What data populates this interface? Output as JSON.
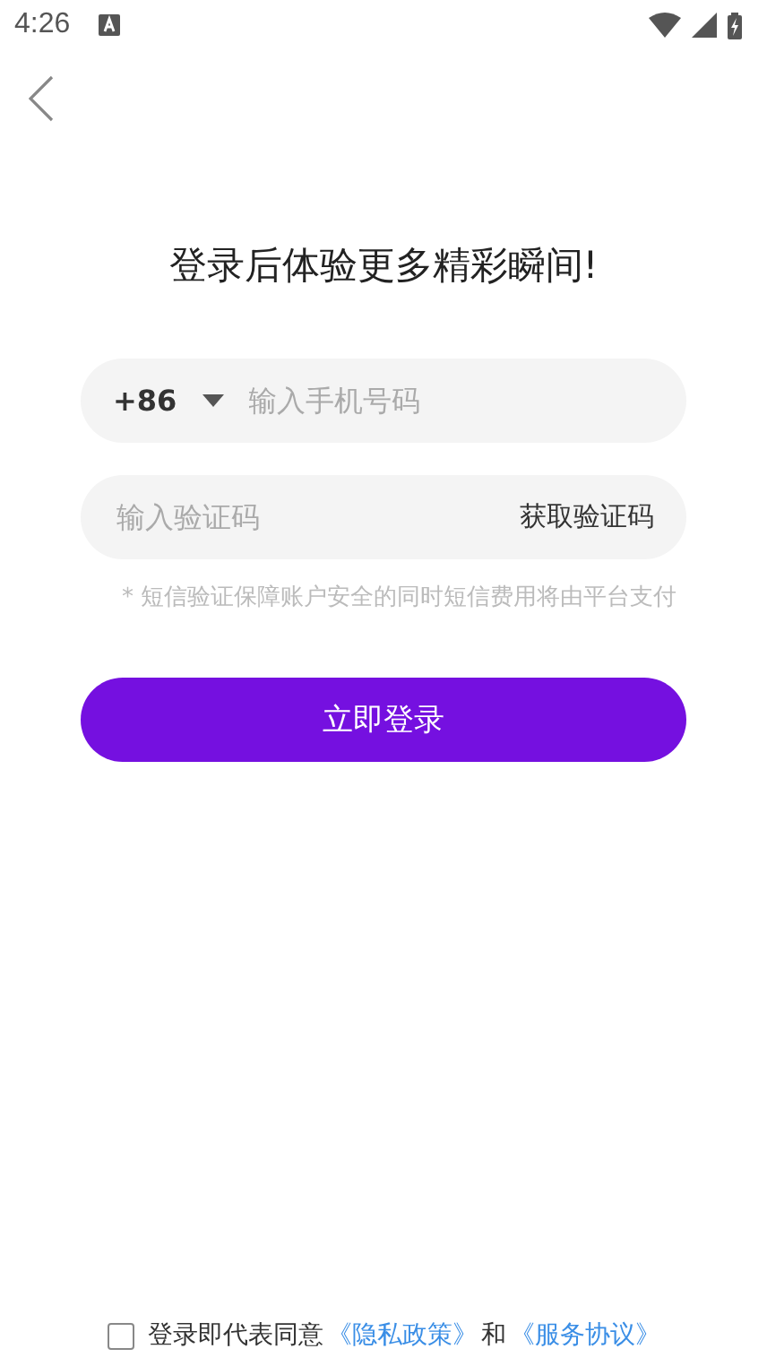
{
  "status_bar": {
    "time": "4:26"
  },
  "title": "登录后体验更多精彩瞬间!",
  "phone_field": {
    "country_code": "+86",
    "placeholder": "输入手机号码"
  },
  "code_field": {
    "placeholder": "输入验证码",
    "action": "获取验证码"
  },
  "note": "* 短信验证保障账户安全的同时短信费用将由平台支付",
  "login_button": "立即登录",
  "agreement": {
    "checked": false,
    "text": "登录即代表同意",
    "privacy_link": "《隐私政策》",
    "joiner": "和",
    "terms_link": "《服务协议》"
  }
}
